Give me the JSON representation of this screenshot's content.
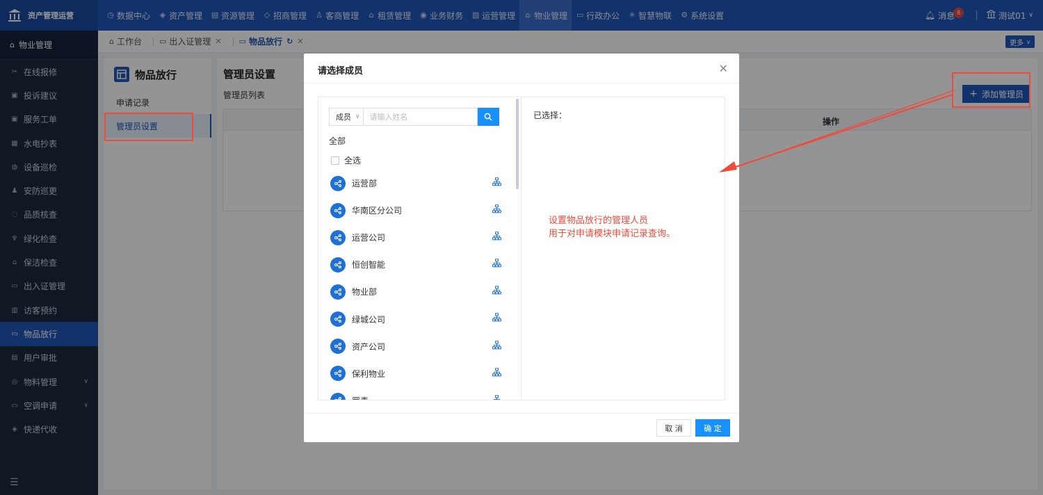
{
  "app": {
    "title": "资产管理运营"
  },
  "nav": [
    {
      "label": "数据中心",
      "icon": "clock-icon"
    },
    {
      "label": "资产管理",
      "icon": "cube-icon"
    },
    {
      "label": "资源管理",
      "icon": "building-icon"
    },
    {
      "label": "招商管理",
      "icon": "diamond-icon"
    },
    {
      "label": "客商管理",
      "icon": "users-icon"
    },
    {
      "label": "租赁管理",
      "icon": "house-icon"
    },
    {
      "label": "业务财务",
      "icon": "coin-icon"
    },
    {
      "label": "运营管理",
      "icon": "chart-icon"
    },
    {
      "label": "物业管理",
      "icon": "home-icon"
    },
    {
      "label": "行政办公",
      "icon": "monitor-icon"
    },
    {
      "label": "智慧物联",
      "icon": "atom-icon"
    },
    {
      "label": "系统设置",
      "icon": "gear-icon"
    }
  ],
  "top": {
    "message_label": "消息",
    "message_count": "8",
    "user_name": "测试01"
  },
  "sidebar": {
    "head": "物业管理",
    "items": [
      {
        "label": "在线报修",
        "icon": "wrench-icon"
      },
      {
        "label": "投诉建议",
        "icon": "clipboard-icon"
      },
      {
        "label": "服务工单",
        "icon": "ticket-icon"
      },
      {
        "label": "水电抄表",
        "icon": "meter-icon"
      },
      {
        "label": "设备巡检",
        "icon": "device-icon"
      },
      {
        "label": "安防巡更",
        "icon": "guard-icon"
      },
      {
        "label": "品质核查",
        "icon": "shield-icon"
      },
      {
        "label": "绿化检查",
        "icon": "plant-icon"
      },
      {
        "label": "保洁检查",
        "icon": "broom-icon"
      },
      {
        "label": "出入证管理",
        "icon": "card-icon"
      },
      {
        "label": "访客预约",
        "icon": "visitor-icon"
      },
      {
        "label": "物品放行",
        "icon": "box-icon"
      },
      {
        "label": "用户审批",
        "icon": "doc-icon"
      },
      {
        "label": "物料管理",
        "icon": "material-icon"
      },
      {
        "label": "空调申请",
        "icon": "aircon-icon"
      },
      {
        "label": "快递代收",
        "icon": "parcel-icon"
      }
    ]
  },
  "tabs": [
    {
      "label": "工作台"
    },
    {
      "label": "出入证管理"
    },
    {
      "label": "物品放行"
    }
  ],
  "more_label": "更多",
  "left_panel": {
    "title": "物品放行",
    "items": [
      "申请记录",
      "管理员设置"
    ]
  },
  "main": {
    "title": "管理员设置",
    "subtitle": "管理员列表",
    "add_button": "添加管理员",
    "op_col": "操作"
  },
  "dialog": {
    "title": "请选择成员",
    "select_value": "成员",
    "search_placeholder": "请输入姓名",
    "all_label": "全部",
    "select_all": "全选",
    "orgs": [
      "运营部",
      "华南区分公司",
      "运营公司",
      "恒创智能",
      "物业部",
      "绿城公司",
      "资产公司",
      "保利物业",
      "罗青"
    ],
    "selected_label": "已选择：",
    "note_line1": "设置物品放行的管理人员",
    "note_line2": "用于对申请模块申请记录查询。",
    "cancel": "取 消",
    "ok": "确 定"
  },
  "colors": {
    "primary": "#1f56b8",
    "accent": "#1890ff",
    "annotation": "#f04b3a",
    "sidebar": "#1e2a3e"
  }
}
